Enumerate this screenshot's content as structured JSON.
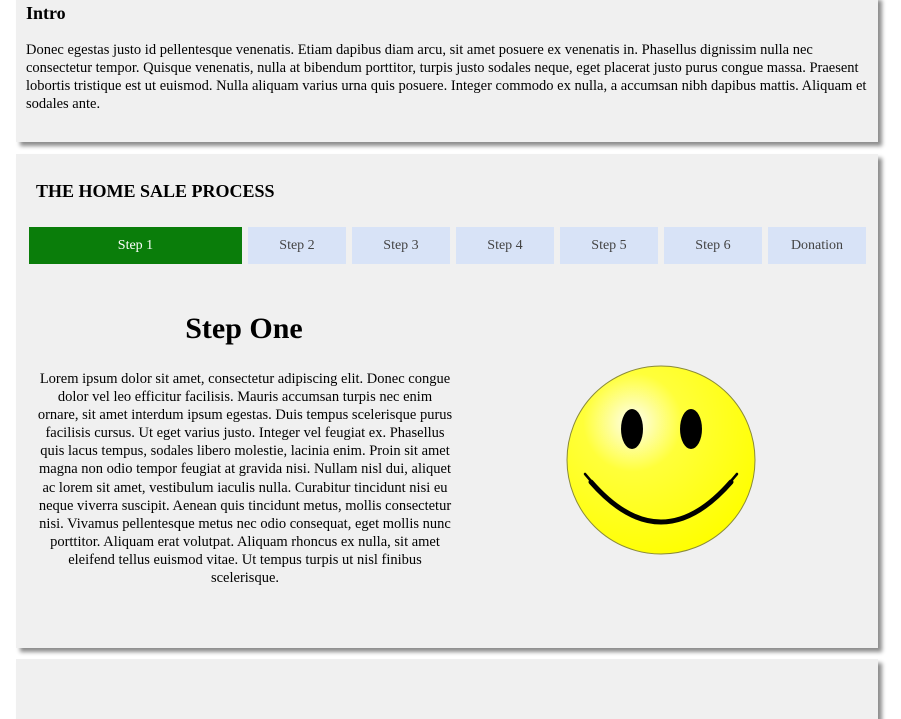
{
  "intro": {
    "title": "Intro",
    "body": "Donec egestas justo id pellentesque venenatis. Etiam dapibus diam arcu, sit amet posuere ex venenatis in. Phasellus dignissim nulla nec consectetur tempor. Quisque venenatis, nulla at bibendum porttitor, turpis justo sodales neque, eget placerat justo purus congue massa. Praesent lobortis tristique est ut euismod. Nulla aliquam varius urna quis posuere. Integer commodo ex nulla, a accumsan nibh dapibus mattis. Aliquam et sodales ante."
  },
  "process": {
    "title": "THE HOME SALE PROCESS",
    "tabs": [
      {
        "label": "Step 1",
        "active": true
      },
      {
        "label": "Step 2",
        "active": false
      },
      {
        "label": "Step 3",
        "active": false
      },
      {
        "label": "Step 4",
        "active": false
      },
      {
        "label": "Step 5",
        "active": false
      },
      {
        "label": "Step 6",
        "active": false
      },
      {
        "label": "Donation",
        "active": false
      }
    ],
    "step": {
      "heading": "Step One",
      "body": "Lorem ipsum dolor sit amet, consectetur adipiscing elit. Donec congue dolor vel leo efficitur facilisis. Mauris accumsan turpis nec enim ornare, sit amet interdum ipsum egestas. Duis tempus scelerisque purus facilisis cursus. Ut eget varius justo. Integer vel feugiat ex. Phasellus quis lacus tempus, sodales libero molestie, lacinia enim. Proin sit amet magna non odio tempor feugiat at gravida nisi. Nullam nisl dui, aliquet ac lorem sit amet, vestibulum iaculis nulla. Curabitur tincidunt nisi eu neque viverra suscipit. Aenean quis tincidunt metus, mollis consectetur nisi. Vivamus pellentesque metus nec odio consequat, eget mollis nunc porttitor. Aliquam erat volutpat. Aliquam rhoncus ex nulla, sit amet eleifend tellus euismod vitae. Ut tempus turpis ut nisl finibus scelerisque.",
      "image_icon": "smiley-face-icon"
    }
  },
  "colors": {
    "active_tab": "#0a7d0a",
    "inactive_tab": "#d8e3f7",
    "card_background": "#f0f0f0",
    "smiley_yellow": "#ffff00"
  }
}
